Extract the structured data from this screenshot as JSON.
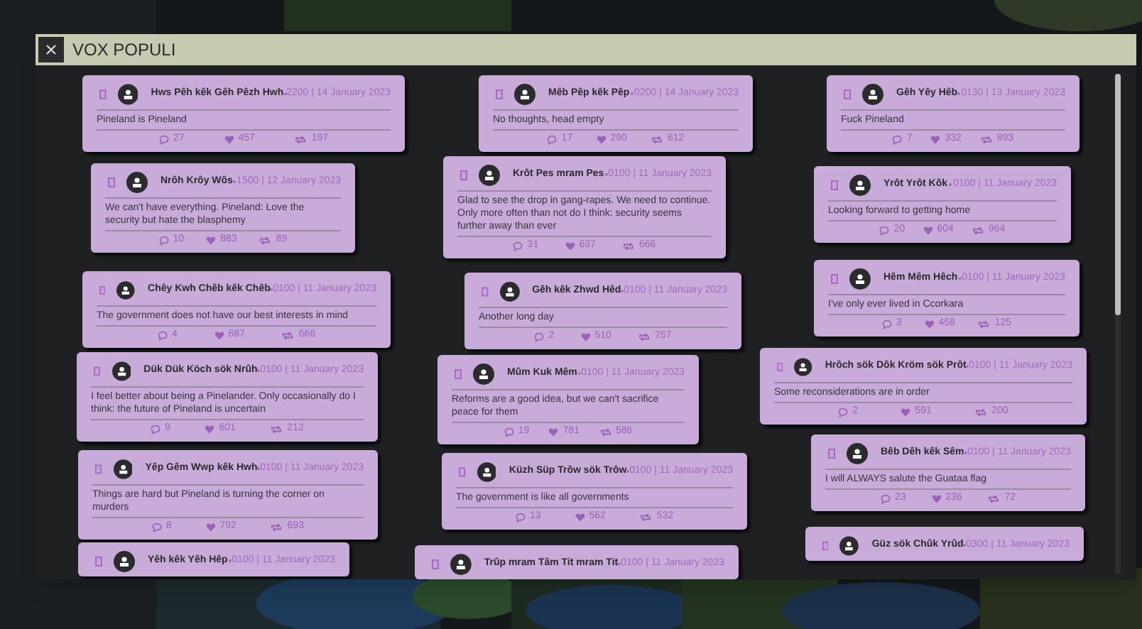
{
  "window": {
    "title": "VOX POPULI"
  },
  "columns": [
    {
      "posts": [
        {
          "name": "Hws Pêh kêk Gêh Pêzh Hwh",
          "time": "2200 | 14 January 2023",
          "text": "Pineland is Pineland",
          "comments": "27",
          "likes": "457",
          "shares": "197"
        },
        {
          "name": "Nrôh Krôy Wôs",
          "time": "1500 | 12 January 2023",
          "text": "We can't have everything. Pineland: Love the security but hate the blasphemy",
          "comments": "10",
          "likes": "883",
          "shares": "89"
        },
        {
          "name": "Chêy Kwh Chêb kêk Chêb",
          "time": "0100 | 11 January 2023",
          "text": "The government does not have our best interests in mind",
          "comments": "4",
          "likes": "687",
          "shares": "666"
        },
        {
          "name": "Dük Dük Köch sök Nrûh",
          "time": "0100 | 11 January 2023",
          "text": "I feel better about being a Pinelander. Only occasionally do I think: the future of Pineland is uncertain",
          "comments": "9",
          "likes": "601",
          "shares": "212"
        },
        {
          "name": "Yêp Gêm Wwp kêk Hwh",
          "time": "0100 | 11 January 2023",
          "text": "Things are hard but Pineland is turning the corner on murders",
          "comments": "8",
          "likes": "792",
          "shares": "693"
        },
        {
          "name": "Yêh kêk Yêh Hêp",
          "time": "0100 | 11 January 2023"
        }
      ]
    },
    {
      "posts": [
        {
          "name": "Mêb Pêp kêk Pêp",
          "time": "0200 | 14 January 2023",
          "text": "No thoughts, head empty",
          "comments": "17",
          "likes": "290",
          "shares": "612"
        },
        {
          "name": "Krôt Pes mram Pes",
          "time": "0100 | 11 January 2023",
          "text": "Glad to see the drop in gang-rapes. We need to continue. Only more often than not do I think: security seems further away than ever",
          "comments": "31",
          "likes": "637",
          "shares": "666"
        },
        {
          "name": "Gêh kêk Zhwd Hêd",
          "time": "0100 | 11 January 2023",
          "text": "Another long day",
          "comments": "2",
          "likes": "510",
          "shares": "757"
        },
        {
          "name": "Mûm Kuk Mêm",
          "time": "0100 | 11 January 2023",
          "text": "Reforms are a good idea, but we can't sacrifice peace for them",
          "comments": "19",
          "likes": "781",
          "shares": "586"
        },
        {
          "name": "Küzh Süp Trôw sök Trôw",
          "time": "0100 | 11 January 2023",
          "text": "The government is like all governments",
          "comments": "13",
          "likes": "562",
          "shares": "532"
        },
        {
          "name": "Trûp mram Tâm Tit mram Tit",
          "time": "0100 | 11 January 2023"
        }
      ]
    },
    {
      "posts": [
        {
          "name": "Gêh Yêy Hêb",
          "time": "0130 | 13 January 2023",
          "text": "Fuck Pineland",
          "comments": "7",
          "likes": "332",
          "shares": "893"
        },
        {
          "name": "Yrôt Yrôt Kôk",
          "time": "0100 | 11 January 2023",
          "text": "Looking forward to getting home",
          "comments": "20",
          "likes": "604",
          "shares": "964"
        },
        {
          "name": "Hêm Mêm Hêch",
          "time": "0100 | 11 January 2023",
          "text": "I've only ever lived in Ccorkara",
          "comments": "3",
          "likes": "458",
          "shares": "125"
        },
        {
          "name": "Hrôch sök Dôk Kröm sök Prôt",
          "time": "0100 | 11 January 2023",
          "text": "Some reconsiderations are in order",
          "comments": "2",
          "likes": "591",
          "shares": "200"
        },
        {
          "name": "Bêb Dêh kêk Sêm",
          "time": "0100 | 11 January 2023",
          "text": "I will ALWAYS salute the Guataa flag",
          "comments": "23",
          "likes": "236",
          "shares": "72"
        },
        {
          "name": "Güz sök Chûk Yrûd",
          "time": "0300 | 11 January 2023"
        }
      ]
    }
  ]
}
